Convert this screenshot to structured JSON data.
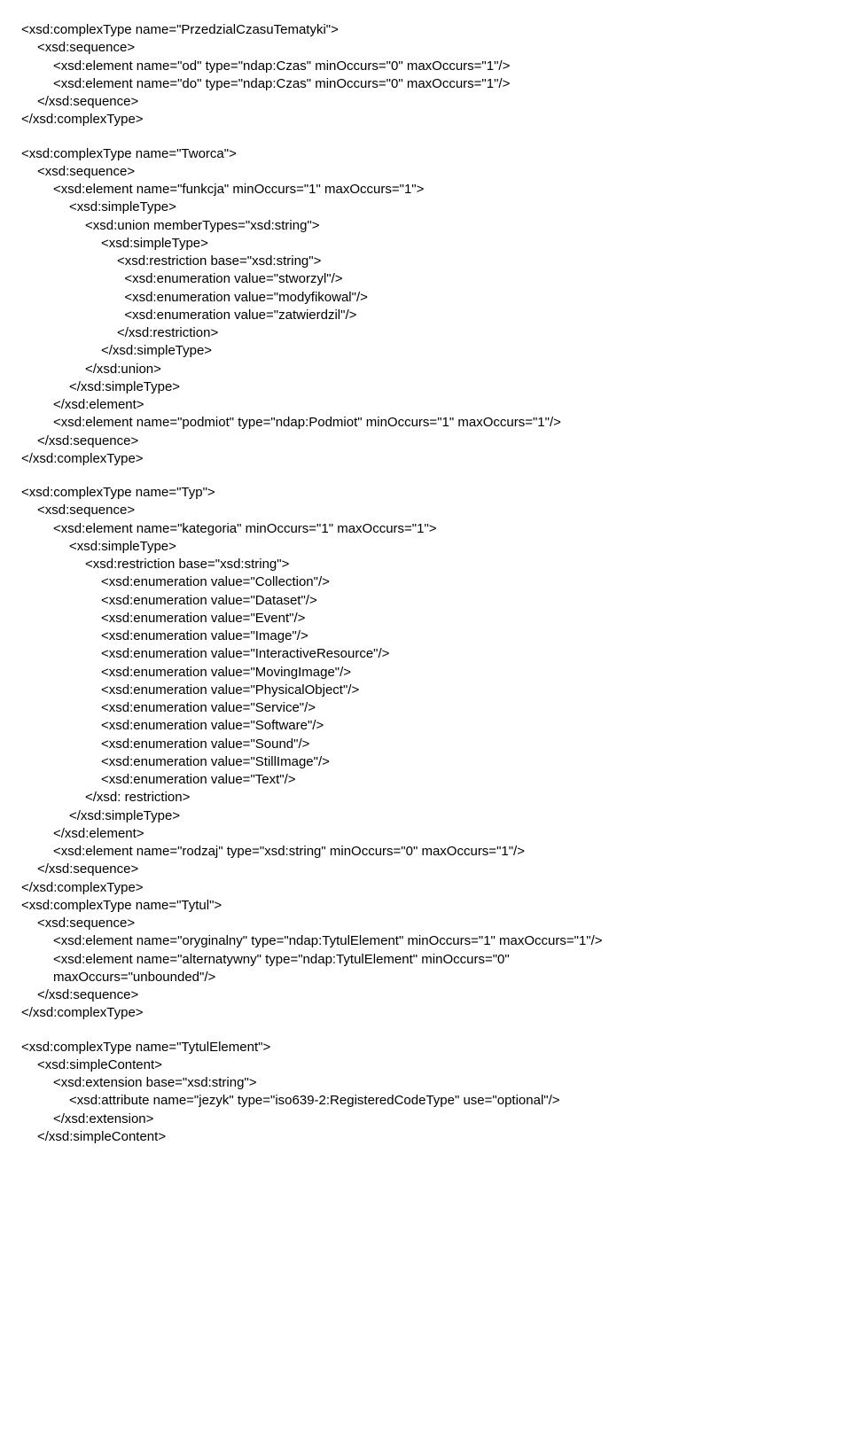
{
  "lines": [
    {
      "indent": 0,
      "text": "<xsd:complexType name=\"PrzedzialCzasuTematyki\">"
    },
    {
      "indent": 1,
      "text": "<xsd:sequence>"
    },
    {
      "indent": 2,
      "text": "<xsd:element name=\"od\" type=\"ndap:Czas\" minOccurs=\"0\" maxOccurs=\"1\"/>"
    },
    {
      "indent": 2,
      "text": "<xsd:element name=\"do\" type=\"ndap:Czas\" minOccurs=\"0\" maxOccurs=\"1\"/>"
    },
    {
      "indent": 1,
      "text": "</xsd:sequence>"
    },
    {
      "indent": 0,
      "text": "</xsd:complexType>"
    },
    {
      "blank": true
    },
    {
      "indent": 0,
      "text": "<xsd:complexType name=\"Tworca\">"
    },
    {
      "indent": 1,
      "text": "<xsd:sequence>"
    },
    {
      "indent": 2,
      "text": "<xsd:element name=\"funkcja\" minOccurs=\"1\" maxOccurs=\"1\">"
    },
    {
      "indent": 3,
      "text": "<xsd:simpleType>"
    },
    {
      "indent": 4,
      "text": "<xsd:union memberTypes=\"xsd:string\">"
    },
    {
      "indent": 5,
      "text": "<xsd:simpleType>"
    },
    {
      "indent": 6,
      "text": "<xsd:restriction base=\"xsd:string\">"
    },
    {
      "indent": 6,
      "text": "  <xsd:enumeration value=\"stworzyl\"/>"
    },
    {
      "indent": 6,
      "text": "  <xsd:enumeration value=\"modyfikowal\"/>"
    },
    {
      "indent": 6,
      "text": "  <xsd:enumeration value=\"zatwierdzil\"/>"
    },
    {
      "indent": 6,
      "text": "</xsd:restriction>"
    },
    {
      "indent": 5,
      "text": "</xsd:simpleType>"
    },
    {
      "indent": 4,
      "text": "</xsd:union>"
    },
    {
      "indent": 3,
      "text": "</xsd:simpleType>"
    },
    {
      "indent": 2,
      "text": "</xsd:element>"
    },
    {
      "indent": 2,
      "text": "<xsd:element name=\"podmiot\" type=\"ndap:Podmiot\" minOccurs=\"1\" maxOccurs=\"1\"/>"
    },
    {
      "indent": 1,
      "text": "</xsd:sequence>"
    },
    {
      "indent": 0,
      "text": "</xsd:complexType>"
    },
    {
      "blank": true
    },
    {
      "indent": 0,
      "text": "<xsd:complexType name=\"Typ\">"
    },
    {
      "indent": 1,
      "text": "<xsd:sequence>"
    },
    {
      "indent": 2,
      "text": "<xsd:element name=\"kategoria\" minOccurs=\"1\" maxOccurs=\"1\">"
    },
    {
      "indent": 3,
      "text": "<xsd:simpleType>"
    },
    {
      "indent": 4,
      "text": "<xsd:restriction base=\"xsd:string\">"
    },
    {
      "indent": 5,
      "text": "<xsd:enumeration value=\"Collection\"/>"
    },
    {
      "indent": 5,
      "text": "<xsd:enumeration value=\"Dataset\"/>"
    },
    {
      "indent": 5,
      "text": "<xsd:enumeration value=\"Event\"/>"
    },
    {
      "indent": 5,
      "text": "<xsd:enumeration value=\"Image\"/>"
    },
    {
      "indent": 5,
      "text": "<xsd:enumeration value=\"InteractiveResource\"/>"
    },
    {
      "indent": 5,
      "text": "<xsd:enumeration value=\"MovingImage\"/>"
    },
    {
      "indent": 5,
      "text": "<xsd:enumeration value=\"PhysicalObject\"/>"
    },
    {
      "indent": 5,
      "text": "<xsd:enumeration value=\"Service\"/>"
    },
    {
      "indent": 5,
      "text": "<xsd:enumeration value=\"Software\"/>"
    },
    {
      "indent": 5,
      "text": "<xsd:enumeration value=\"Sound\"/>"
    },
    {
      "indent": 5,
      "text": "<xsd:enumeration value=\"StillImage\"/>"
    },
    {
      "indent": 5,
      "text": "<xsd:enumeration value=\"Text\"/>"
    },
    {
      "indent": 4,
      "text": "</xsd: restriction>"
    },
    {
      "indent": 3,
      "text": "</xsd:simpleType>"
    },
    {
      "indent": 2,
      "text": "</xsd:element>"
    },
    {
      "indent": 2,
      "text": "<xsd:element name=\"rodzaj\" type=\"xsd:string\" minOccurs=\"0\" maxOccurs=\"1\"/>"
    },
    {
      "indent": 1,
      "text": "</xsd:sequence>"
    },
    {
      "indent": 0,
      "text": "</xsd:complexType>"
    },
    {
      "indent": 0,
      "text": "<xsd:complexType name=\"Tytul\">"
    },
    {
      "indent": 1,
      "text": "<xsd:sequence>"
    },
    {
      "indent": 2,
      "text": "<xsd:element name=\"oryginalny\" type=\"ndap:TytulElement\" minOccurs=\"1\" maxOccurs=\"1\"/>"
    },
    {
      "indent": 2,
      "text": "<xsd:element name=\"alternatywny\" type=\"ndap:TytulElement\" minOccurs=\"0\""
    },
    {
      "indent": 2,
      "text": "maxOccurs=\"unbounded\"/>"
    },
    {
      "indent": 1,
      "text": "</xsd:sequence>"
    },
    {
      "indent": 0,
      "text": "</xsd:complexType>"
    },
    {
      "blank": true
    },
    {
      "indent": 0,
      "text": "<xsd:complexType name=\"TytulElement\">"
    },
    {
      "indent": 1,
      "text": "<xsd:simpleContent>"
    },
    {
      "indent": 2,
      "text": "<xsd:extension base=\"xsd:string\">"
    },
    {
      "indent": 3,
      "text": "<xsd:attribute name=\"jezyk\" type=\"iso639-2:RegisteredCodeType\" use=\"optional\"/>"
    },
    {
      "indent": 2,
      "text": "</xsd:extension>"
    },
    {
      "indent": 1,
      "text": "</xsd:simpleContent>"
    }
  ]
}
